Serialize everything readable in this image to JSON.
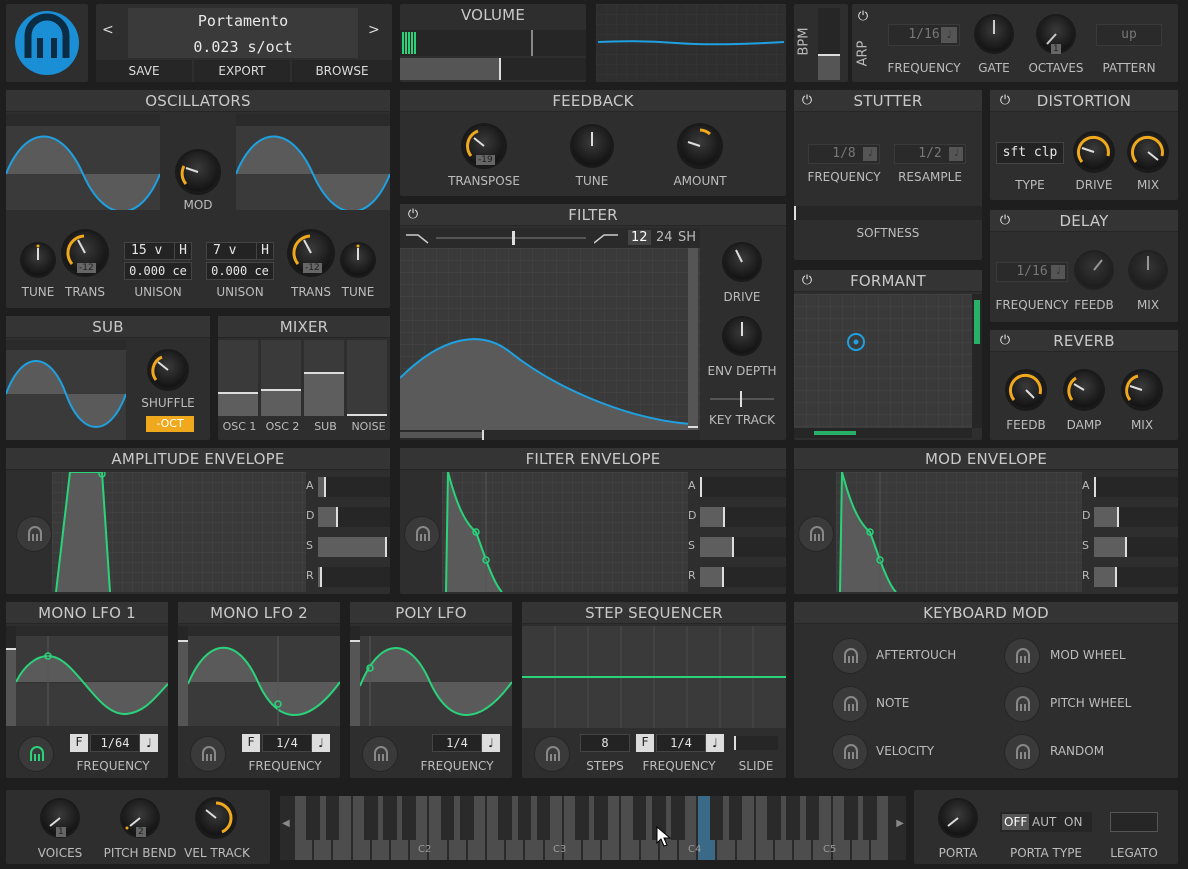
{
  "preset": {
    "name": "Portamento",
    "value": "0.023 s/oct",
    "prev": "<",
    "next": ">",
    "save": "SAVE",
    "export": "EXPORT",
    "browse": "BROWSE"
  },
  "volume": {
    "title": "VOLUME"
  },
  "bpm": {
    "label": "BPM"
  },
  "arp": {
    "label": "ARP",
    "frequency": "1/16",
    "frequency_label": "FREQUENCY",
    "gate_label": "GATE",
    "octaves_label": "OCTAVES",
    "octaves_value": "1",
    "pattern": "up",
    "pattern_label": "PATTERN"
  },
  "oscillators": {
    "title": "OSCILLATORS",
    "mod": "MOD",
    "osc1": {
      "tune": "TUNE",
      "trans": "TRANS",
      "trans_value": "-12",
      "unison_voices": "15 v",
      "unison_h": "H",
      "unison_detune": "0.000 ce",
      "unison": "UNISON"
    },
    "osc2": {
      "tune": "TUNE",
      "trans": "TRANS",
      "trans_value": "-12",
      "unison_voices": "7 v",
      "unison_h": "H",
      "unison_detune": "0.000 ce",
      "unison": "UNISON"
    }
  },
  "sub": {
    "title": "SUB",
    "shuffle": "SHUFFLE",
    "oct": "-OCT"
  },
  "mixer": {
    "title": "MIXER",
    "channels": [
      {
        "label": "OSC 1",
        "level": 0.32
      },
      {
        "label": "OSC 2",
        "level": 0.36
      },
      {
        "label": "SUB",
        "level": 0.58
      },
      {
        "label": "NOISE",
        "level": 0.03
      }
    ]
  },
  "feedback": {
    "title": "FEEDBACK",
    "transpose": "TRANSPOSE",
    "transpose_value": "-19",
    "tune": "TUNE",
    "amount": "AMOUNT"
  },
  "filter": {
    "title": "FILTER",
    "slope12": "12",
    "slope24": "24",
    "sh": "SH",
    "drive": "DRIVE",
    "env_depth": "ENV DEPTH",
    "key_track": "KEY TRACK"
  },
  "stutter": {
    "title": "STUTTER",
    "frequency": "1/8",
    "frequency_label": "FREQUENCY",
    "resample": "1/2",
    "resample_label": "RESAMPLE",
    "softness": "SOFTNESS"
  },
  "formant": {
    "title": "FORMANT"
  },
  "distortion": {
    "title": "DISTORTION",
    "type": "sft clp",
    "type_label": "TYPE",
    "drive": "DRIVE",
    "mix": "MIX"
  },
  "delay": {
    "title": "DELAY",
    "frequency": "1/16",
    "frequency_label": "FREQUENCY",
    "feedb": "FEEDB",
    "mix": "MIX"
  },
  "reverb": {
    "title": "REVERB",
    "feedb": "FEEDB",
    "damp": "DAMP",
    "mix": "MIX"
  },
  "amp_env": {
    "title": "AMPLITUDE ENVELOPE",
    "a": "A",
    "d": "D",
    "s": "S",
    "r": "R",
    "levels": [
      0.12,
      0.28,
      0.98,
      0.05
    ]
  },
  "filter_env": {
    "title": "FILTER ENVELOPE",
    "a": "A",
    "d": "D",
    "s": "S",
    "r": "R",
    "levels": [
      0.02,
      0.3,
      0.4,
      0.28
    ]
  },
  "mod_env": {
    "title": "MOD ENVELOPE",
    "a": "A",
    "d": "D",
    "s": "S",
    "r": "R",
    "levels": [
      0.02,
      0.3,
      0.4,
      0.28
    ]
  },
  "lfo1": {
    "title": "MONO LFO 1",
    "f": "F",
    "rate": "1/64",
    "frequency": "FREQUENCY"
  },
  "lfo2": {
    "title": "MONO LFO 2",
    "f": "F",
    "rate": "1/4",
    "frequency": "FREQUENCY"
  },
  "poly_lfo": {
    "title": "POLY LFO",
    "rate": "1/4",
    "frequency": "FREQUENCY"
  },
  "step_seq": {
    "title": "STEP SEQUENCER",
    "steps_value": "8",
    "steps": "STEPS",
    "f": "F",
    "rate": "1/4",
    "frequency": "FREQUENCY",
    "slide": "SLIDE"
  },
  "keyboard_mod": {
    "title": "KEYBOARD MOD",
    "aftertouch": "AFTERTOUCH",
    "mod_wheel": "MOD WHEEL",
    "note": "NOTE",
    "pitch_wheel": "PITCH WHEEL",
    "velocity": "VELOCITY",
    "random": "RANDOM"
  },
  "bottom": {
    "voices": "VOICES",
    "voices_value": "1",
    "pitch_bend": "PITCH BEND",
    "pitch_bend_value": "2",
    "vel_track": "VEL TRACK"
  },
  "keyboard": {
    "c2": "C2",
    "c3": "C3",
    "c4": "C4",
    "c5": "C5"
  },
  "porta": {
    "porta": "PORTA",
    "off": "OFF",
    "aut": "AUT",
    "on": "ON",
    "porta_type": "PORTA TYPE",
    "legato": "LEGATO"
  },
  "colors": {
    "accent_blue": "#1fa0e0",
    "accent_green": "#2ad37a",
    "accent_orange": "#f0a81c"
  }
}
